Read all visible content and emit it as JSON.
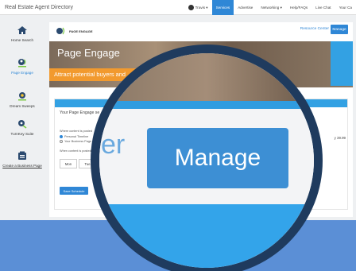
{
  "topbar": {
    "brand": "Real Estate Agent Directory",
    "nav": [
      {
        "label": "Travis ▾",
        "active": false
      },
      {
        "label": "Services",
        "active": true
      },
      {
        "label": "Advertise",
        "active": false
      },
      {
        "label": "Networking ▾",
        "active": false
      },
      {
        "label": "Help/FAQs",
        "active": false
      },
      {
        "label": "Live Chat",
        "active": false
      },
      {
        "label": "Your Ca",
        "active": false
      }
    ]
  },
  "sidebar": {
    "items": [
      {
        "label": "Home Search",
        "icon": "house-icon",
        "active": false
      },
      {
        "label": "Page Engage",
        "icon": "page-engage-icon",
        "active": true
      },
      {
        "label": "Dream Sweeps",
        "icon": "trophy-icon",
        "active": false
      },
      {
        "label": "TurnKey Suite",
        "icon": "key-icon",
        "active": false
      },
      {
        "label": "Create a Business Page",
        "icon": "business-page-icon",
        "active": false
      }
    ]
  },
  "panel": {
    "logo_text": "PAGE ENGAGE",
    "resource_link": "Resource Center",
    "manage_label": "Manage",
    "hero_title": "Page Engage",
    "hero_subtitle": "Attract potential buyers and",
    "card": {
      "title": "Your Page Engage se",
      "where_label": "Where content is posted",
      "option_personal": "Personal Timeline",
      "option_business": "Your Business Page",
      "when_label": "When content is posted",
      "day_mon": "Mon",
      "day_tue": "Tue",
      "save_label": "Save Schedule",
      "right_text": "y 39.99"
    }
  },
  "magnifier": {
    "ghost_text": "er",
    "manage_label": "Manage"
  },
  "colors": {
    "accent": "#2f87d6",
    "orange": "#f29a2e",
    "ring": "#1f3b5e",
    "background": "#5b8fd6"
  }
}
